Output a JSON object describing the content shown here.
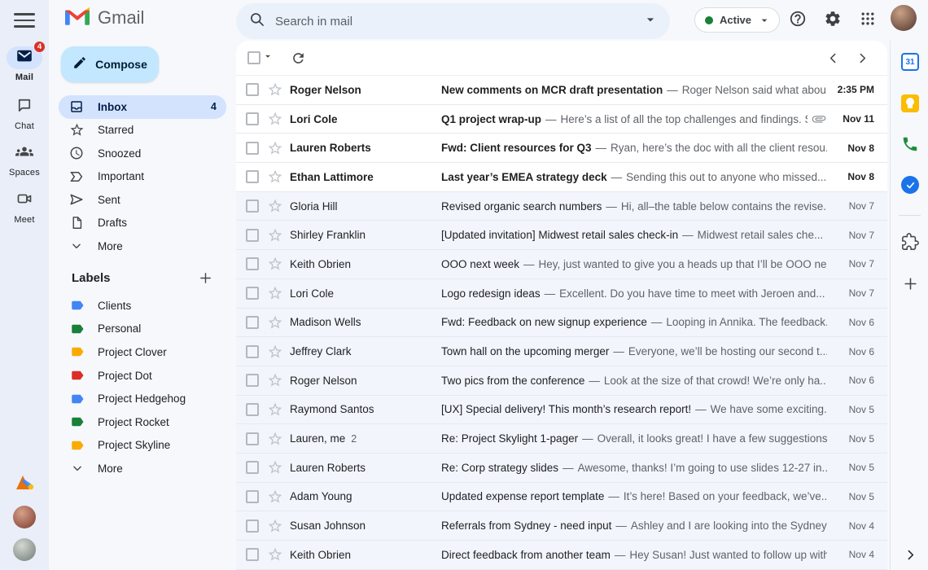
{
  "topbar": {
    "search_placeholder": "Search in mail",
    "status_label": "Active"
  },
  "rail": {
    "items": [
      {
        "label": "Mail",
        "badge": "4"
      },
      {
        "label": "Chat"
      },
      {
        "label": "Spaces"
      },
      {
        "label": "Meet"
      }
    ]
  },
  "sidebar": {
    "app_name": "Gmail",
    "compose_label": "Compose",
    "nav": [
      {
        "label": "Inbox",
        "count": "4"
      },
      {
        "label": "Starred"
      },
      {
        "label": "Snoozed"
      },
      {
        "label": "Important"
      },
      {
        "label": "Sent"
      },
      {
        "label": "Drafts"
      },
      {
        "label": "More"
      }
    ],
    "labels_header": "Labels",
    "labels": [
      {
        "name": "Clients",
        "color": "#4285f4"
      },
      {
        "name": "Personal",
        "color": "#188038"
      },
      {
        "name": "Project Clover",
        "color": "#f9ab00"
      },
      {
        "name": "Project Dot",
        "color": "#d93025"
      },
      {
        "name": "Project Hedgehog",
        "color": "#4285f4"
      },
      {
        "name": "Project Rocket",
        "color": "#188038"
      },
      {
        "name": "Project Skyline",
        "color": "#f9ab00"
      }
    ],
    "labels_more": "More"
  },
  "list": {
    "separator": "—",
    "emails": [
      {
        "sender": "Roger Nelson",
        "subject": "New comments on MCR draft presentation",
        "snippet": "Roger Nelson said what abou...",
        "date": "2:35 PM",
        "unread": true
      },
      {
        "sender": "Lori Cole",
        "subject": "Q1 project wrap-up",
        "snippet": "Here’s a list of all the top challenges and findings. Sur...",
        "date": "Nov 11",
        "unread": true,
        "attachment": true
      },
      {
        "sender": "Lauren Roberts",
        "subject": "Fwd: Client resources for Q3",
        "snippet": "Ryan, here’s the doc with all the client resou...",
        "date": "Nov 8",
        "unread": true
      },
      {
        "sender": "Ethan Lattimore",
        "subject": "Last year’s EMEA strategy deck",
        "snippet": "Sending this out to anyone who missed...",
        "date": "Nov 8",
        "unread": true
      },
      {
        "sender": "Gloria Hill",
        "subject": "Revised organic search numbers",
        "snippet": "Hi, all–the table below contains the revise...",
        "date": "Nov 7"
      },
      {
        "sender": "Shirley Franklin",
        "subject": "[Updated invitation] Midwest retail sales check-in",
        "snippet": "Midwest retail sales che...",
        "date": "Nov 7"
      },
      {
        "sender": "Keith Obrien",
        "subject": "OOO next week",
        "snippet": "Hey, just wanted to give you a heads up that I’ll be OOO ne...",
        "date": "Nov 7"
      },
      {
        "sender": "Lori Cole",
        "subject": "Logo redesign ideas",
        "snippet": "Excellent. Do you have time to meet with Jeroen and...",
        "date": "Nov 7"
      },
      {
        "sender": "Madison Wells",
        "subject": "Fwd: Feedback on new signup experience",
        "snippet": "Looping in Annika. The feedback...",
        "date": "Nov 6"
      },
      {
        "sender": "Jeffrey Clark",
        "subject": "Town hall on the upcoming merger",
        "snippet": "Everyone, we’ll be hosting our second t...",
        "date": "Nov 6"
      },
      {
        "sender": "Roger Nelson",
        "subject": "Two pics from the conference",
        "snippet": "Look at the size of that crowd! We’re only ha...",
        "date": "Nov 6"
      },
      {
        "sender": "Raymond Santos",
        "subject": "[UX] Special delivery! This month’s research report!",
        "snippet": "We have some exciting...",
        "date": "Nov 5"
      },
      {
        "sender": "Lauren, me",
        "thread_count": "2",
        "subject": "Re: Project Skylight 1-pager",
        "snippet": "Overall, it looks great! I have a few suggestions...",
        "date": "Nov 5"
      },
      {
        "sender": "Lauren Roberts",
        "subject": "Re: Corp strategy slides",
        "snippet": "Awesome, thanks! I’m going to use slides 12-27 in...",
        "date": "Nov 5"
      },
      {
        "sender": "Adam Young",
        "subject": "Updated expense report template",
        "snippet": "It’s here! Based on your feedback, we’ve...",
        "date": "Nov 5"
      },
      {
        "sender": "Susan Johnson",
        "subject": "Referrals from Sydney - need input",
        "snippet": "Ashley and I are looking into the Sydney ...",
        "date": "Nov 4"
      },
      {
        "sender": "Keith Obrien",
        "subject": "Direct feedback from another team",
        "snippet": "Hey Susan! Just wanted to follow up with s...",
        "date": "Nov 4"
      }
    ]
  },
  "right_rail": {
    "calendar_day": "31",
    "icons": [
      "calendar",
      "keep",
      "voice",
      "tasks",
      "get-addons",
      "add",
      "expand-panel"
    ]
  }
}
